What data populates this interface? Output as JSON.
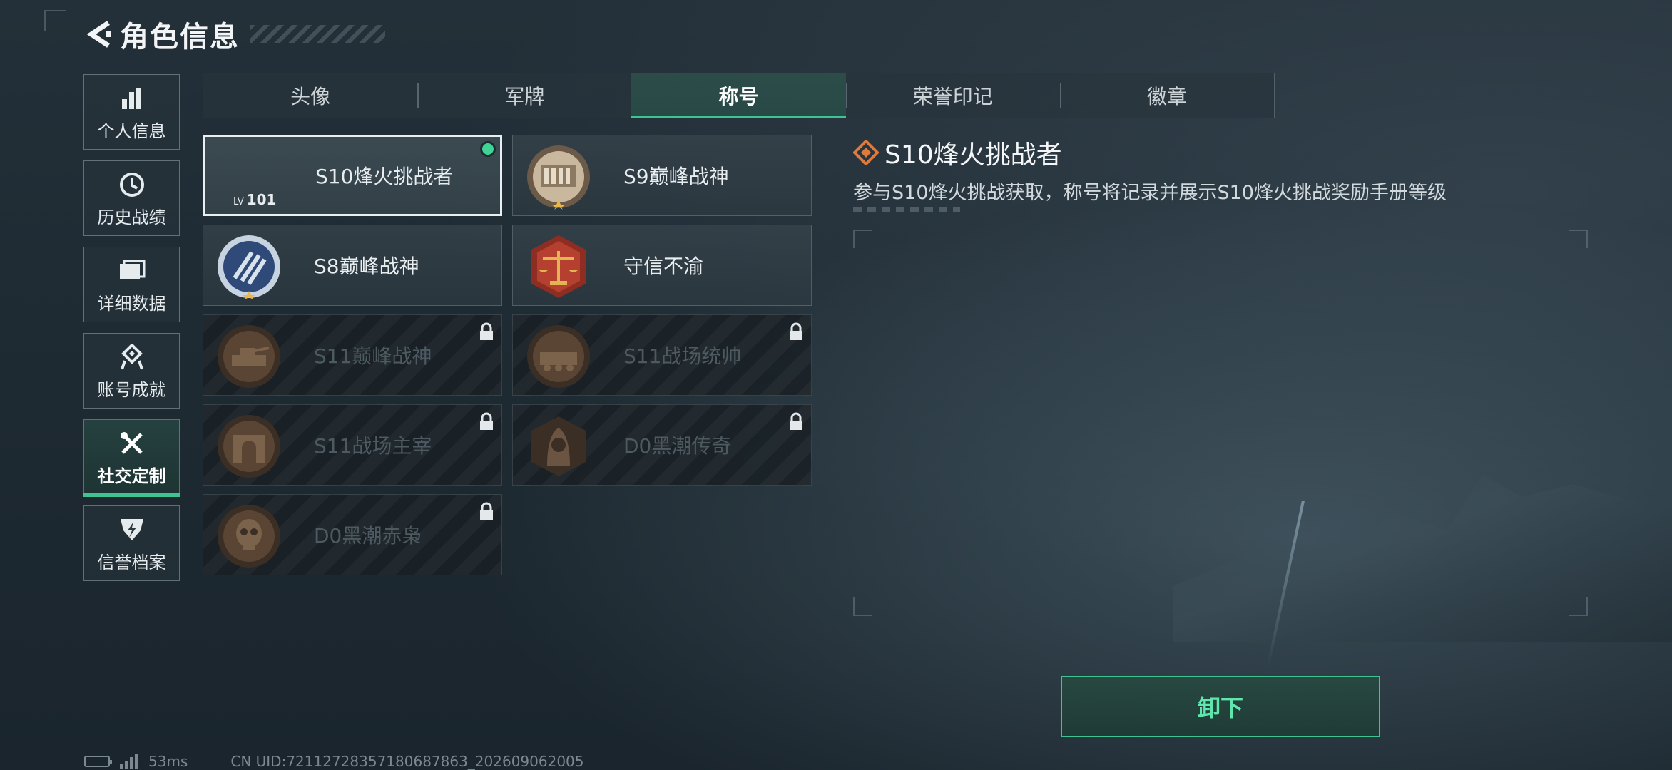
{
  "header": {
    "title": "角色信息"
  },
  "sidebar": {
    "items": [
      {
        "label": "个人信息",
        "icon": "bar-chart-icon",
        "active": false
      },
      {
        "label": "历史战绩",
        "icon": "history-clock-icon",
        "active": false
      },
      {
        "label": "详细数据",
        "icon": "folder-icon",
        "active": false
      },
      {
        "label": "账号成就",
        "icon": "achievement-icon",
        "active": false
      },
      {
        "label": "社交定制",
        "icon": "tools-icon",
        "active": true
      },
      {
        "label": "信誉档案",
        "icon": "reputation-icon",
        "active": false
      }
    ]
  },
  "tabs": [
    {
      "label": "头像",
      "active": false
    },
    {
      "label": "军牌",
      "active": false
    },
    {
      "label": "称号",
      "active": true
    },
    {
      "label": "荣誉印记",
      "active": false
    },
    {
      "label": "徽章",
      "active": false
    }
  ],
  "titles": [
    {
      "name": "S10烽火挑战者",
      "selected": true,
      "locked": false,
      "lv_label": "LV",
      "lv_value": "101",
      "icon": "title-badge-icon"
    },
    {
      "name": "S9巅峰战神",
      "selected": false,
      "locked": false,
      "icon": "fortress-emblem-icon"
    },
    {
      "name": "S8巅峰战神",
      "selected": false,
      "locked": false,
      "icon": "striped-medal-icon"
    },
    {
      "name": "守信不渝",
      "selected": false,
      "locked": false,
      "icon": "scales-emblem-icon"
    },
    {
      "name": "S11巅峰战神",
      "selected": false,
      "locked": true,
      "icon": "tank-emblem-icon"
    },
    {
      "name": "S11战场统帅",
      "selected": false,
      "locked": true,
      "icon": "apc-emblem-icon"
    },
    {
      "name": "S11战场主宰",
      "selected": false,
      "locked": true,
      "icon": "arch-emblem-icon"
    },
    {
      "name": "D0黑潮传奇",
      "selected": false,
      "locked": true,
      "icon": "hooded-figure-emblem-icon"
    },
    {
      "name": "D0黑潮赤枭",
      "selected": false,
      "locked": true,
      "icon": "skull-emblem-icon"
    }
  ],
  "detail": {
    "title": "S10烽火挑战者",
    "description": "参与S10烽火挑战获取，称号将记录并展示S10烽火挑战奖励手册等级"
  },
  "actions": {
    "unequip_label": "卸下"
  },
  "status": {
    "ping": "53ms",
    "uid": "CN UID:72112728357180687863_202609062005"
  },
  "colors": {
    "accent": "#3fc392",
    "accent_text": "#5fe6ad",
    "equipped_dot": "#3fd496",
    "detail_icon": "#e07a3c"
  }
}
